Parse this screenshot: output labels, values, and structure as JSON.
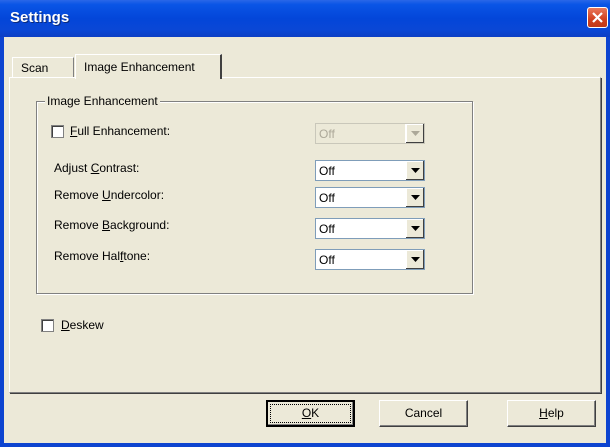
{
  "window": {
    "title": "Settings"
  },
  "tabs": [
    {
      "label": "Scan",
      "active": false
    },
    {
      "label": "Image Enhancement",
      "active": true
    }
  ],
  "group": {
    "label": "Image Enhancement"
  },
  "full_enhancement": {
    "label_pre": "",
    "label_key": "F",
    "label_post": "ull Enhancement:",
    "checked": false,
    "value": "Off",
    "enabled": false
  },
  "rows": [
    {
      "label_pre": "Adjust ",
      "label_key": "C",
      "label_post": "ontrast:",
      "value": "Off"
    },
    {
      "label_pre": "Remove ",
      "label_key": "U",
      "label_post": "ndercolor:",
      "value": "Off"
    },
    {
      "label_pre": "Remove ",
      "label_key": "B",
      "label_post": "ackground:",
      "value": "Off"
    },
    {
      "label_pre": "Remove Hal",
      "label_key": "f",
      "label_post": "tone:",
      "value": "Off"
    }
  ],
  "deskew": {
    "label_key": "D",
    "label_post": "eskew",
    "checked": false
  },
  "buttons": {
    "ok": {
      "label_key": "O",
      "label_post": "K"
    },
    "cancel": {
      "label": "Cancel"
    },
    "help": {
      "label_key": "H",
      "label_post": "elp"
    }
  },
  "colors": {
    "titlebar": "#0a55e6",
    "face": "#ece9d8",
    "close": "#d1401f"
  }
}
